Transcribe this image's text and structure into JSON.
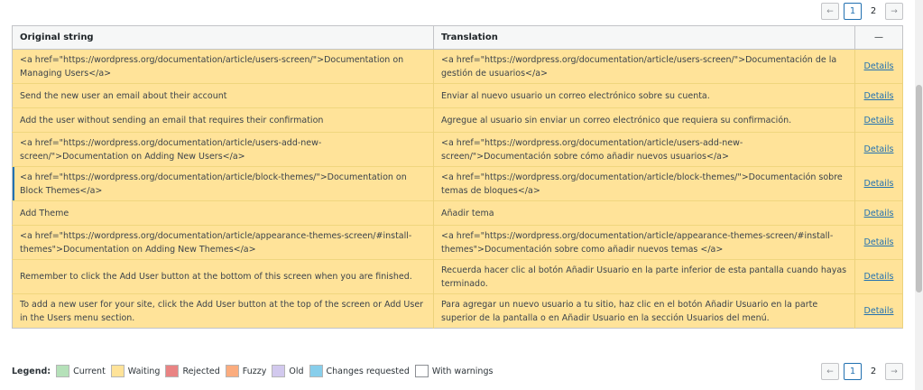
{
  "pagination": {
    "prev_label": "←",
    "next_label": "→",
    "page1": "1",
    "page2": "2"
  },
  "table": {
    "col_original": "Original string",
    "col_translation": "Translation",
    "col_actions": "—",
    "rows": [
      {
        "original": "<a href=\"https://wordpress.org/documentation/article/users-screen/\">Documentation on Managing Users</a>",
        "translation": "<a href=\"https://wordpress.org/documentation/article/users-screen/\">Documentación de la gestión de usuarios</a>",
        "action": "Details"
      },
      {
        "original": "Send the new user an email about their account",
        "translation": "Enviar al nuevo usuario un correo electrónico sobre su cuenta.",
        "action": "Details"
      },
      {
        "original": "Add the user without sending an email that requires their confirmation",
        "translation": "Agregue al usuario sin enviar un correo electrónico que requiera su confirmación.",
        "action": "Details"
      },
      {
        "original": "<a href=\"https://wordpress.org/documentation/article/users-add-new-screen/\">Documentation on Adding New Users</a>",
        "translation": "<a href=\"https://wordpress.org/documentation/article/users-add-new-screen/\">Documentación sobre cómo añadir nuevos usuarios</a>",
        "action": "Details"
      },
      {
        "original": "<a href=\"https://wordpress.org/documentation/article/block-themes/\">Documentation on Block Themes</a>",
        "translation": "<a href=\"https://wordpress.org/documentation/article/block-themes/\">Documentación sobre temas de bloques</a>",
        "action": "Details"
      },
      {
        "original": "Add Theme",
        "translation": "Añadir tema",
        "action": "Details"
      },
      {
        "original": "<a href=\"https://wordpress.org/documentation/article/appearance-themes-screen/#install-themes\">Documentation on Adding New Themes</a>",
        "translation": "<a href=\"https://wordpress.org/documentation/article/appearance-themes-screen/#install-themes\">Documentación sobre como añadir nuevos temas </a>",
        "action": "Details"
      },
      {
        "original": "Remember to click the Add User button at the bottom of this screen when you are finished.",
        "translation": "Recuerda hacer clic al botón Añadir Usuario en la parte inferior de esta pantalla cuando hayas terminado.",
        "action": "Details"
      },
      {
        "original": "To add a new user for your site, click the Add User button at the top of the screen or Add User in the Users menu section.",
        "translation": "Para agregar un nuevo usuario a tu sitio, haz clic en el botón Añadir Usuario en la parte superior de la pantalla o en Añadir Usuario en la sección Usuarios del menú.",
        "action": "Details"
      }
    ]
  },
  "legend": {
    "title": "Legend:",
    "items": [
      {
        "label": "Current",
        "color": "#b5e1b9"
      },
      {
        "label": "Waiting",
        "color": "#ffe399"
      },
      {
        "label": "Rejected",
        "color": "#e98383"
      },
      {
        "label": "Fuzzy",
        "color": "#fbac7e"
      },
      {
        "label": "Old",
        "color": "#d2c9ee"
      },
      {
        "label": "Changes requested",
        "color": "#87ceeb"
      },
      {
        "label": "With warnings",
        "color": "#ffffff"
      }
    ]
  },
  "colors": {
    "waiting_row": "#ffe399",
    "accent": "#2271b1"
  }
}
